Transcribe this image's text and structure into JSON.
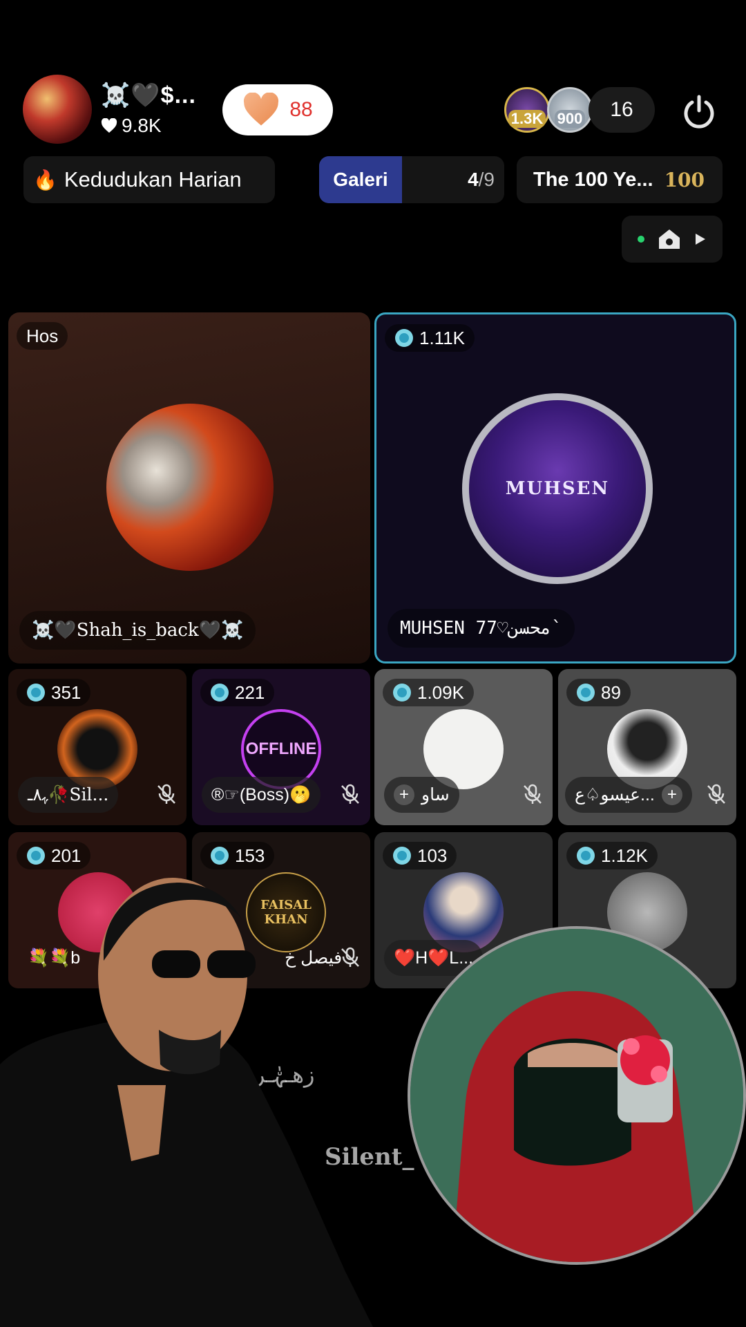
{
  "header": {
    "host_name": "☠️🖤$...",
    "host_likes": "9.8K",
    "heart_count": "88",
    "viewer_badges": [
      "1.3K",
      "900"
    ],
    "viewer_count": "16"
  },
  "toolbar": {
    "daily_rank_label": "Kedudukan Harian",
    "gallery_label": "Galeri",
    "gallery_current": "4",
    "gallery_total": "/9",
    "event_label": "The 100 Ye...",
    "event_badge": "100"
  },
  "seats_big": [
    {
      "tag": "Hos",
      "name": "☠️🖤Shah_is_back🖤☠️"
    },
    {
      "tag": "1.11K",
      "name": "MUHSEN 77♡محسن`"
    }
  ],
  "seats_small": [
    {
      "score": "351",
      "name": "ﮩ٨ـ🥀Sil..."
    },
    {
      "score": "221",
      "name": "®☞(Boss)🫢",
      "avatar_text": "OFFLINE"
    },
    {
      "score": "1.09K",
      "name": "ساو"
    },
    {
      "score": "89",
      "name": "عيسو♤ع..."
    },
    {
      "score": "201",
      "name": "💐💐b"
    },
    {
      "score": "153",
      "name": "فيصل خ",
      "avatar_text": "FAISAL KHAN"
    },
    {
      "score": "103",
      "name": "❤️H❤️L..."
    },
    {
      "score": "1.12K",
      "name": ""
    }
  ],
  "overlay_texts": [
    "زهـہٰ٘ـر",
    "Silent_"
  ],
  "colors": {
    "accent_cyan": "#3aa6c2",
    "heart_red": "#e0322e",
    "gallery_blue": "#2d3a8f",
    "gold": "#d9b45b"
  }
}
